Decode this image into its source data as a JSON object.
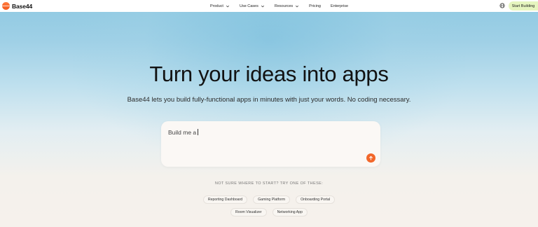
{
  "header": {
    "brand": "Base44",
    "nav": [
      {
        "label": "Product",
        "has_dropdown": true
      },
      {
        "label": "Use Cases",
        "has_dropdown": true
      },
      {
        "label": "Resources",
        "has_dropdown": true
      },
      {
        "label": "Pricing",
        "has_dropdown": false
      },
      {
        "label": "Enterprise",
        "has_dropdown": false
      }
    ],
    "language_icon": "globe-icon",
    "cta_label": "Start Building"
  },
  "hero": {
    "title": "Turn your ideas into apps",
    "subtitle": "Base44 lets you build fully-functional apps in minutes with just your words. No coding necessary."
  },
  "prompt": {
    "value": "Build me a",
    "send_icon": "arrow-up-icon"
  },
  "suggestions": {
    "label": "NOT SURE WHERE TO START? TRY ONE OF THESE:",
    "row1": [
      "Reporting Dashboard",
      "Gaming Platform",
      "Onboarding Portal"
    ],
    "row2": [
      "Room Visualizer",
      "Networking App"
    ]
  },
  "colors": {
    "accent": "#f2672a",
    "cta_bg": "#e6f5bf",
    "sky": "#8ec9e2"
  }
}
